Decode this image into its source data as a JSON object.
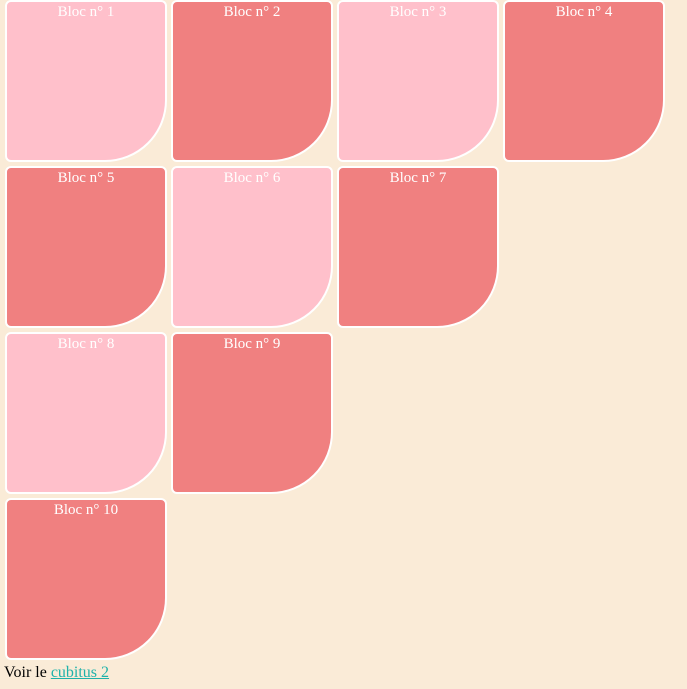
{
  "blocs": [
    {
      "label": "Bloc n° 1",
      "color": "#ffc0cb"
    },
    {
      "label": "Bloc n° 2",
      "color": "#f08080"
    },
    {
      "label": "Bloc n° 3",
      "color": "#ffc0cb"
    },
    {
      "label": "Bloc n° 4",
      "color": "#f08080"
    },
    {
      "label": "Bloc n° 5",
      "color": "#f08080"
    },
    {
      "label": "Bloc n° 6",
      "color": "#ffc0cb"
    },
    {
      "label": "Bloc n° 7",
      "color": "#f08080"
    },
    {
      "label": "Bloc n° 8",
      "color": "#ffc0cb"
    },
    {
      "label": "Bloc n° 9",
      "color": "#f08080"
    },
    {
      "label": "Bloc n° 10",
      "color": "#f08080"
    }
  ],
  "footer": {
    "prefix": "Voir le",
    "link_text": "cubitus 2",
    "link_color": "#20b2aa"
  },
  "background_color": "#faebd7"
}
